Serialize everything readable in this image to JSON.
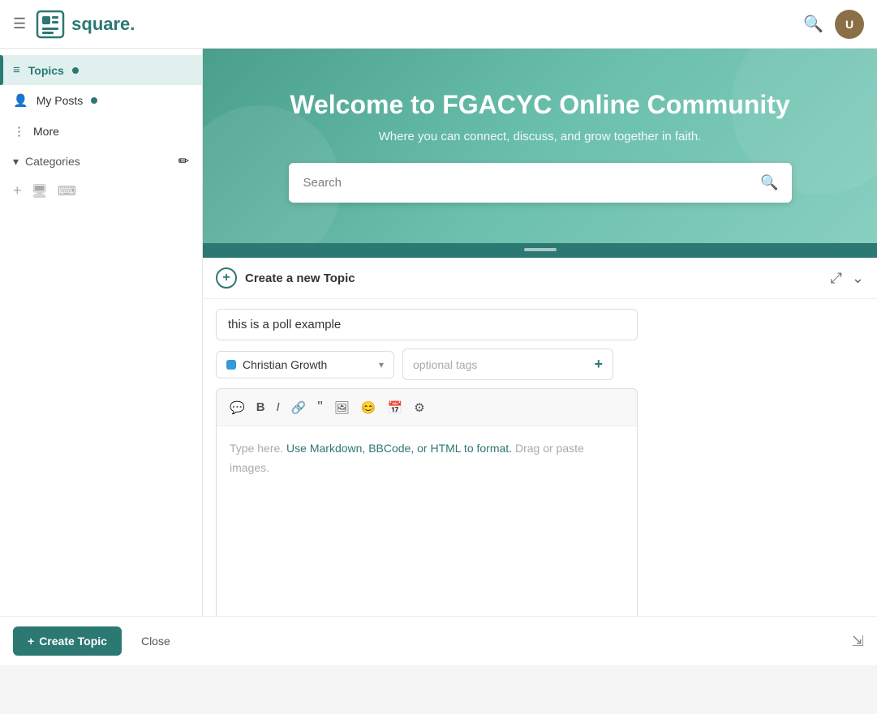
{
  "header": {
    "hamburger": "☰",
    "logo_text": "square.",
    "search_icon": "🔍",
    "avatar_initial": "U"
  },
  "sidebar": {
    "items": [
      {
        "id": "topics",
        "label": "Topics",
        "icon": "☰",
        "active": true,
        "dot": true
      },
      {
        "id": "my-posts",
        "label": "My Posts",
        "icon": "👤",
        "active": false,
        "dot": true
      },
      {
        "id": "more",
        "label": "More",
        "icon": "⋮",
        "active": false,
        "dot": false
      }
    ],
    "categories_label": "Categories",
    "edit_icon": "✏️",
    "add_icon": "+",
    "monitor_icon": "🖥",
    "keyboard_icon": "⌨"
  },
  "hero": {
    "title": "Welcome to FGACYC Online Community",
    "subtitle": "Where you can connect, discuss, and grow together in faith.",
    "search_placeholder": "Search"
  },
  "composer": {
    "header_title": "Create a new Topic",
    "expand_icon": "⤢",
    "collapse_icon": "⌄",
    "topic_title_value": "this is a poll example",
    "category": {
      "label": "Christian Growth",
      "color": "#3498db"
    },
    "tags_placeholder": "optional tags",
    "toolbar": [
      {
        "id": "speech",
        "icon": "💬",
        "label": "quote"
      },
      {
        "id": "bold",
        "icon": "B",
        "label": "bold",
        "style": "bold"
      },
      {
        "id": "italic",
        "icon": "I",
        "label": "italic",
        "style": "italic"
      },
      {
        "id": "link",
        "icon": "🔗",
        "label": "link"
      },
      {
        "id": "blockquote",
        "icon": "❝",
        "label": "blockquote"
      },
      {
        "id": "image",
        "icon": "🖼",
        "label": "image"
      },
      {
        "id": "emoji",
        "icon": "😊",
        "label": "emoji"
      },
      {
        "id": "date",
        "icon": "📅",
        "label": "date"
      },
      {
        "id": "settings",
        "icon": "⚙",
        "label": "settings"
      }
    ],
    "editor_placeholder_parts": [
      "Type here. ",
      "Use Markdown, BBCode, or HTML to format.",
      " Drag or paste images."
    ]
  },
  "footer": {
    "create_btn_icon": "+",
    "create_btn_label": "Create Topic",
    "close_label": "Close",
    "collapse_icon": "⇲"
  }
}
